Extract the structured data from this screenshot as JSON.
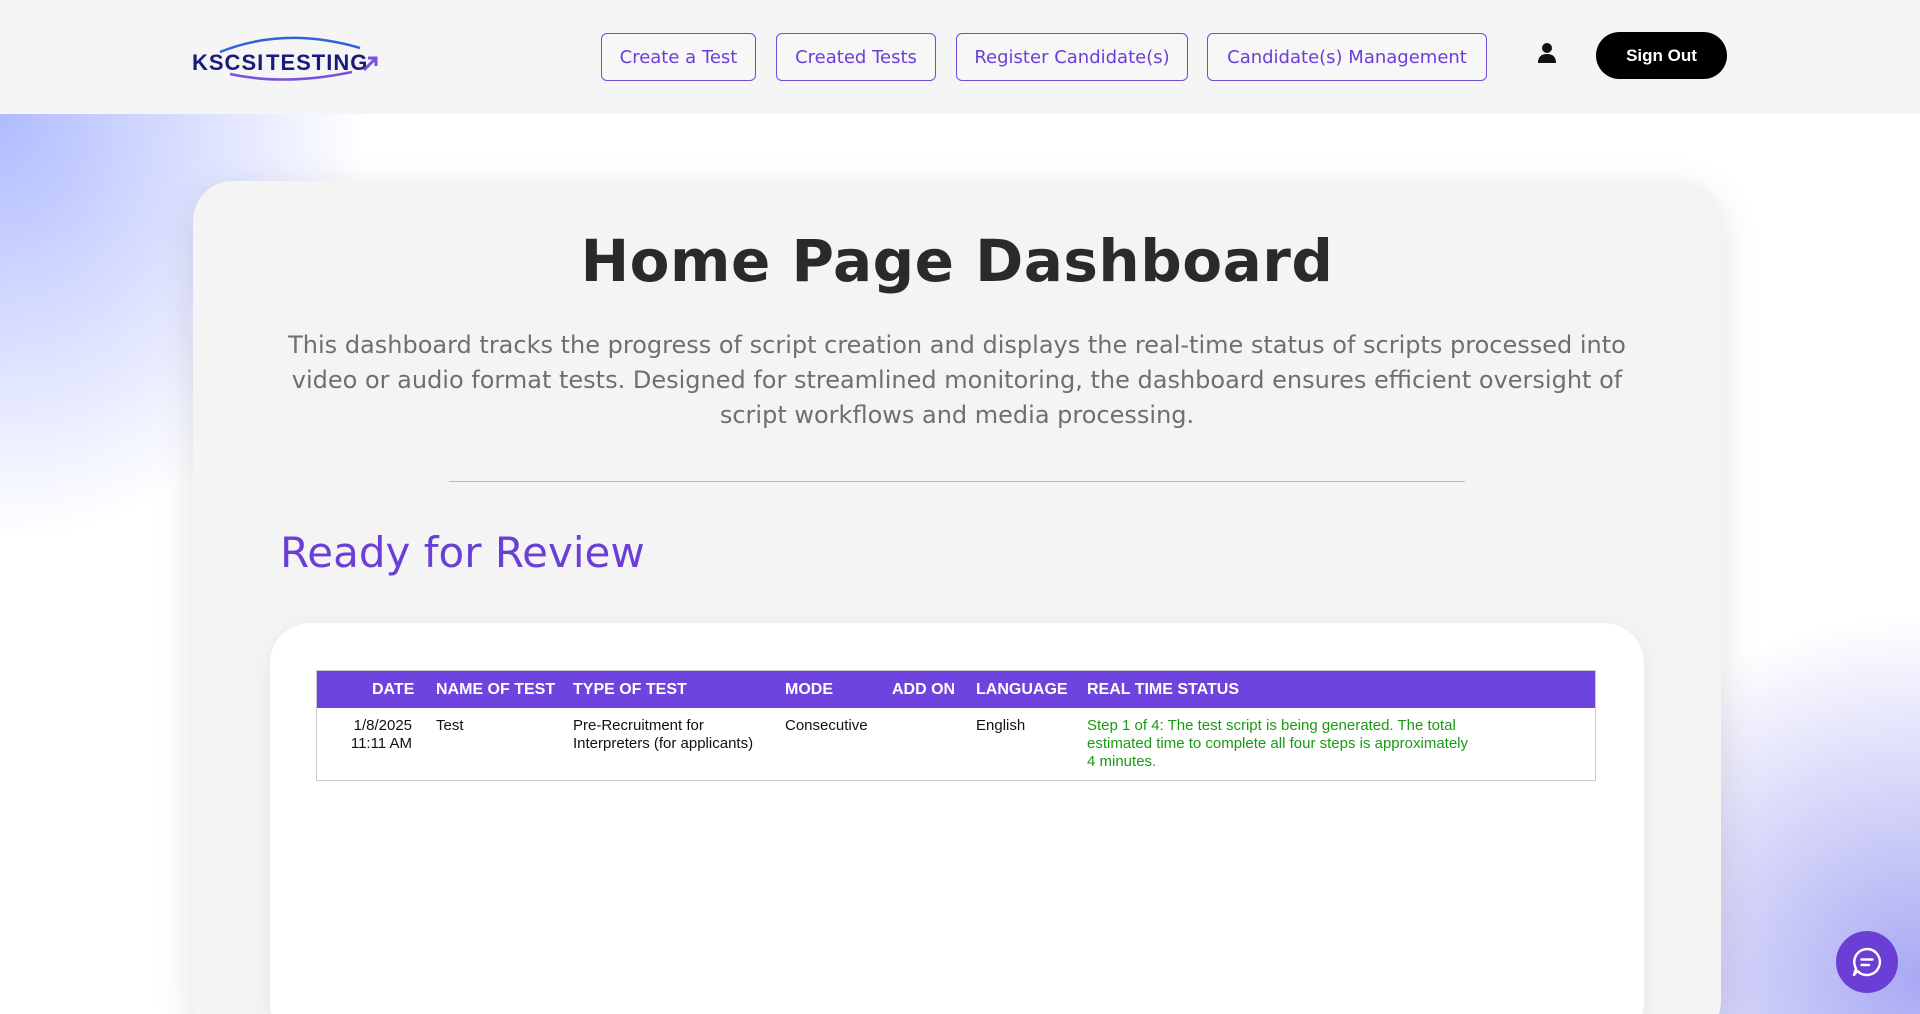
{
  "header": {
    "logo_text": "KSCSI TESTING",
    "nav": [
      {
        "label": "Create a Test"
      },
      {
        "label": "Created Tests"
      },
      {
        "label": "Register Candidate(s)"
      },
      {
        "label": "Candidate(s) Management"
      }
    ],
    "user_icon": "user-icon",
    "sign_out_label": "Sign Out"
  },
  "main": {
    "title": "Home Page Dashboard",
    "description": "This dashboard tracks the progress of script creation and displays the real-time status of scripts processed into video or audio format tests. Designed for streamlined monitoring, the dashboard ensures efficient oversight of script workflows and media processing.",
    "section_title": "Ready for Review"
  },
  "table": {
    "columns": [
      "DATE",
      "NAME OF TEST",
      "TYPE OF TEST",
      "MODE",
      "ADD ON",
      "LANGUAGE",
      "REAL TIME STATUS"
    ],
    "rows": [
      {
        "date": "1/8/2025",
        "time": "11:11 AM",
        "name": "Test",
        "type_line1": "Pre-Recruitment for",
        "type_line2": "Interpreters (for applicants)",
        "mode": "Consecutive",
        "add_on": "",
        "language": "English",
        "status_line1": "Step 1 of 4: The test script is being generated. The total",
        "status_line2": "estimated time to complete all four steps is approximately",
        "status_line3": "4 minutes."
      }
    ]
  },
  "colors": {
    "accent": "#6d44dd",
    "status_green": "#1a9a12",
    "header_bg": "#f5f5f5"
  },
  "chat_icon": "chat-bubble-icon"
}
